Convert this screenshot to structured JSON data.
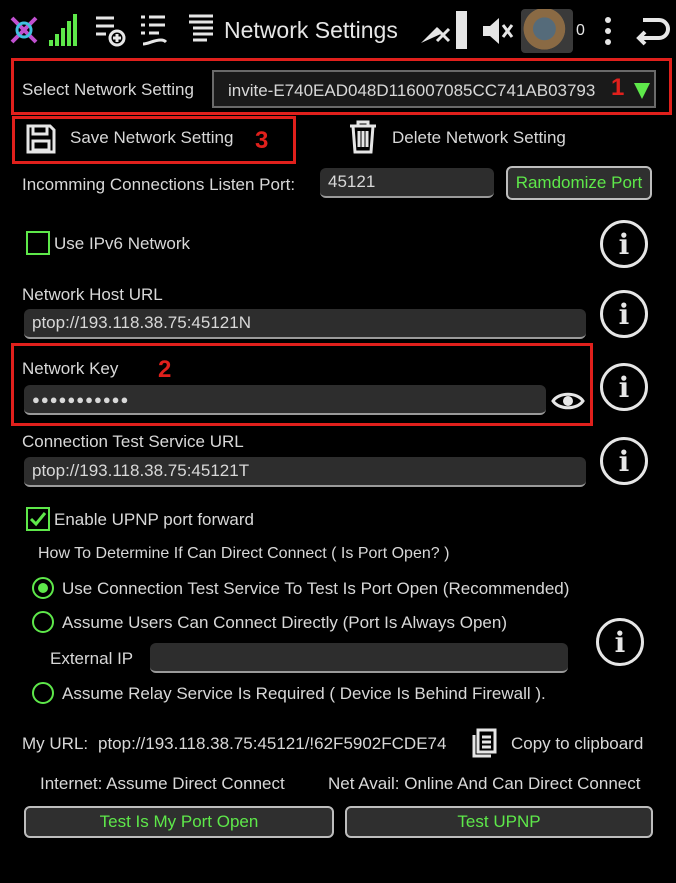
{
  "topbar": {
    "title": "Network Settings",
    "notification_count": "0",
    "icons": [
      "app-logo-icon",
      "signal-bars-icon",
      "settings-add-icon",
      "list-hand-icon",
      "sheet-icon",
      "satellite-off-icon",
      "mute-icon",
      "avatar",
      "more-vert-icon",
      "back-icon"
    ]
  },
  "select": {
    "label": "Select Network Setting",
    "value": "invite-E740EAD048D116007085CC741AB03793"
  },
  "actions": {
    "save_label": "Save Network Setting",
    "delete_label": "Delete Network Setting"
  },
  "port": {
    "label": "Incomming Connections Listen Port:",
    "value": "45121",
    "randomize_label": "Ramdomize Port"
  },
  "ipv6": {
    "label": "Use IPv6 Network",
    "checked": false
  },
  "host": {
    "label": "Network Host URL",
    "value": "ptop://193.118.38.75:45121N"
  },
  "key": {
    "label": "Network Key",
    "value": "●●●●●●●●●●●"
  },
  "test_service": {
    "label": "Connection Test Service URL",
    "value": "ptop://193.118.38.75:45121T"
  },
  "upnp": {
    "label": "Enable UPNP port forward",
    "checked": true
  },
  "direct": {
    "heading": "How To Determine If Can Direct Connect ( Is Port Open? )",
    "options": [
      {
        "label": "Use Connection Test Service To Test Is Port Open (Recommended)",
        "selected": true
      },
      {
        "label": "Assume Users Can Connect Directly (Port Is Always Open)",
        "selected": false
      },
      {
        "label": "Assume Relay Service Is Required ( Device Is Behind Firewall ).",
        "selected": false
      }
    ],
    "external_ip_label": "External IP",
    "external_ip_value": ""
  },
  "myurl": {
    "label": "My URL:",
    "value": "ptop://193.118.38.75:45121/!62F5902FCDE74",
    "copy_label": "Copy to clipboard"
  },
  "status": {
    "internet": "Internet: Assume Direct Connect",
    "net_avail": "Net Avail: Online And Can Direct Connect"
  },
  "buttons": {
    "test_port": "Test Is My Port Open",
    "test_upnp": "Test UPNP"
  },
  "annotations": {
    "one": "1",
    "two": "2",
    "three": "3"
  },
  "colors": {
    "accent_green": "#5ee84a",
    "annotation_red": "#e0201c",
    "field_bg": "#2d2d2d"
  }
}
